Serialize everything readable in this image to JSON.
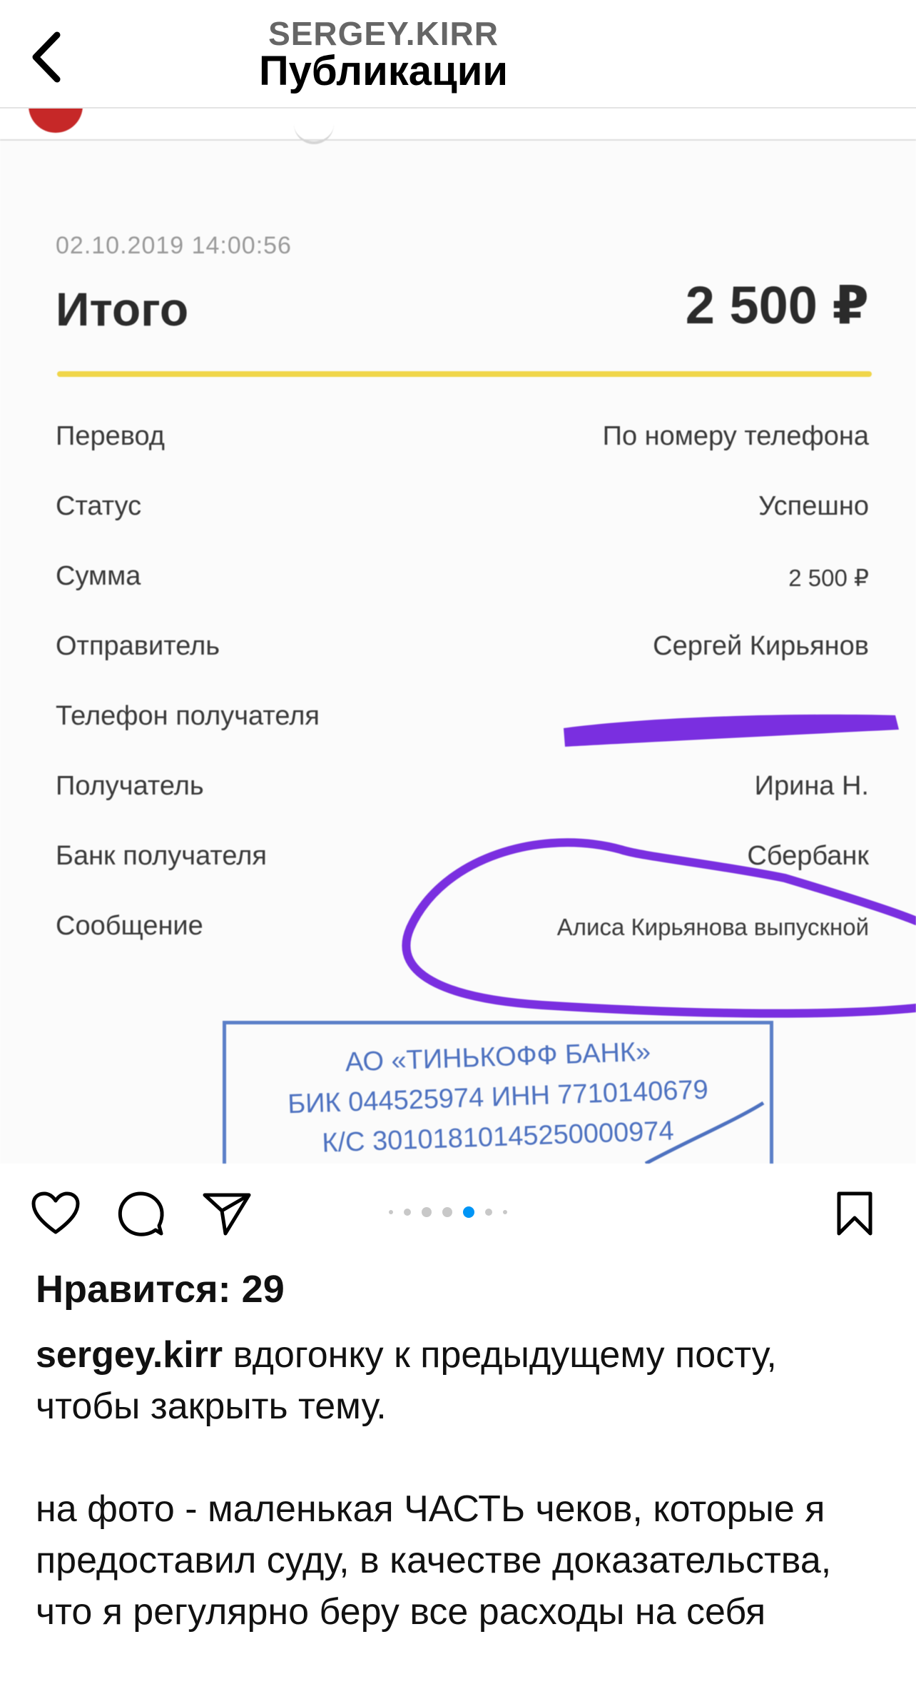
{
  "header": {
    "username": "SERGEY.KIRR",
    "title": "Публикации"
  },
  "receipt": {
    "datetime": "02.10.2019 14:00:56",
    "total_label": "Итого",
    "total_value": "2 500 ₽",
    "rows": [
      {
        "label": "Перевод",
        "value": "По номеру телефона"
      },
      {
        "label": "Статус",
        "value": "Успешно"
      },
      {
        "label": "Сумма",
        "value": "2 500 ₽"
      },
      {
        "label": "Отправитель",
        "value": "Сергей Кирьянов"
      },
      {
        "label": "Телефон получателя",
        "value": ""
      },
      {
        "label": "Получатель",
        "value": "Ирина Н."
      },
      {
        "label": "Банк получателя",
        "value": "Сбербанк"
      },
      {
        "label": "Сообщение",
        "value": "Алиса Кирьянова выпускной"
      }
    ],
    "stamp": [
      "АО «ТИНЬКОФФ БАНК»",
      "БИК 044525974 ИНН 7710140679",
      "К/С 30101810145250000974"
    ],
    "accent_color": "#f0d64a",
    "marker_color": "#7a2fe0"
  },
  "carousel": {
    "count": 7,
    "active": 4,
    "active_color": "#0095f6"
  },
  "post": {
    "likes": "Нравится: 29",
    "username": "sergey.kirr",
    "caption_first": "вдогонку к предыдущему посту, чтобы закрыть тему.",
    "caption_second": "на фото - маленькая ЧАСТЬ чеков, которые я предоставил суду, в качестве доказательства, что я регулярно беру все расходы на себя"
  }
}
